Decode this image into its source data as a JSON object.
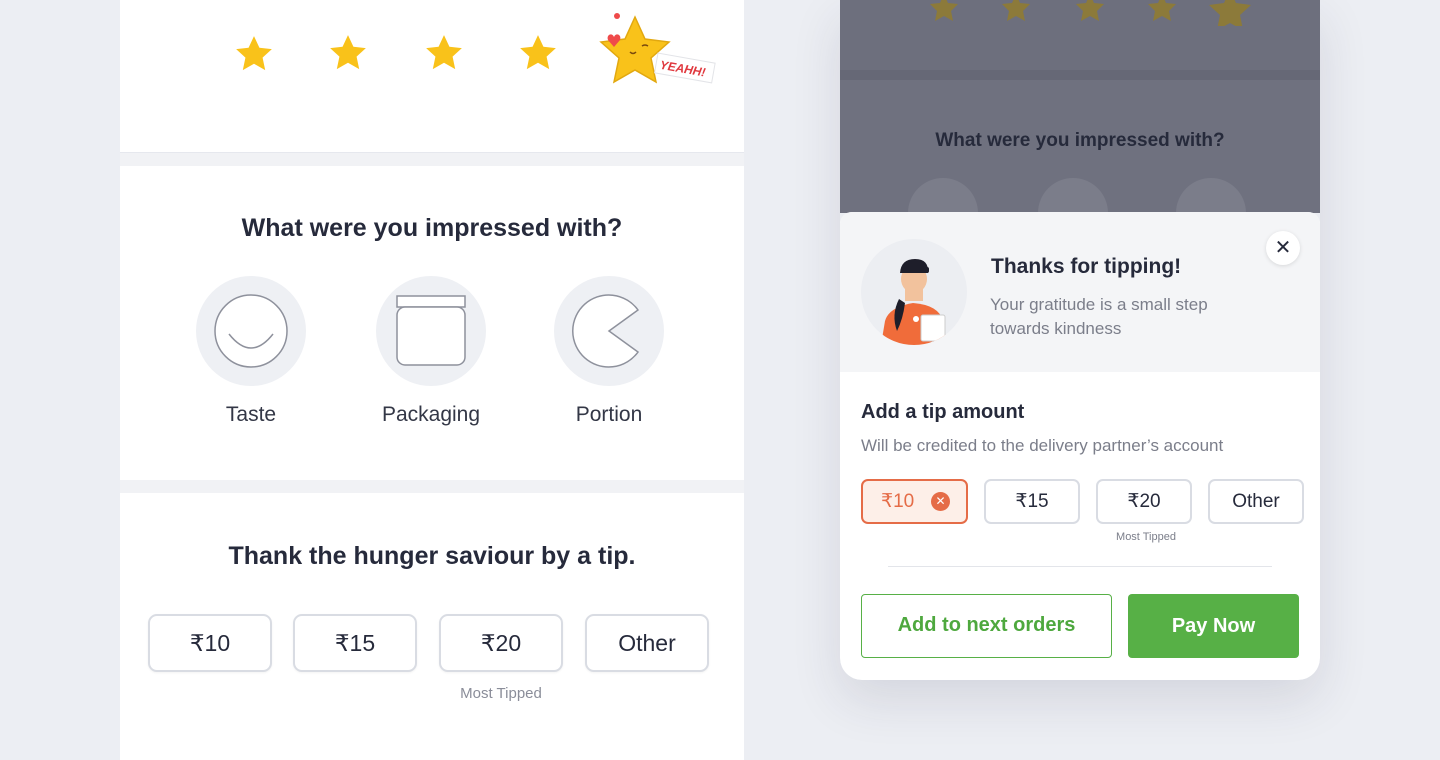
{
  "rating": {
    "stars_filled": 5,
    "stars_total": 5,
    "celebration_text": "YEAHH!"
  },
  "impress": {
    "title": "What were you impressed with?",
    "options": [
      {
        "label": "Taste",
        "icon": "plate-smile-icon"
      },
      {
        "label": "Packaging",
        "icon": "container-icon"
      },
      {
        "label": "Portion",
        "icon": "portion-pie-icon"
      }
    ]
  },
  "tip": {
    "title": "Thank the hunger saviour by a tip.",
    "options": [
      "₹10",
      "₹15",
      "₹20",
      "Other"
    ],
    "most_tipped_label": "Most Tipped"
  },
  "modal": {
    "bg_title": "What were you impressed with?",
    "thanks_title": "Thanks for tipping!",
    "thanks_subtitle": "Your gratitude is a small step towards kindness",
    "close_icon": "close-icon",
    "add_tip_title": "Add a tip amount",
    "add_tip_subtitle": "Will be credited to the delivery partner’s account",
    "tip_options": [
      "₹10",
      "₹15",
      "₹20",
      "Other"
    ],
    "selected_option": "₹10",
    "most_tipped_label": "Most Tipped",
    "secondary_button": "Add to next orders",
    "primary_button": "Pay Now"
  },
  "colors": {
    "star": "#f9c21a",
    "accent_green": "#57b046",
    "selected_orange": "#e56c47",
    "text_dark": "#262a3b",
    "text_muted": "#7b7e8a"
  }
}
